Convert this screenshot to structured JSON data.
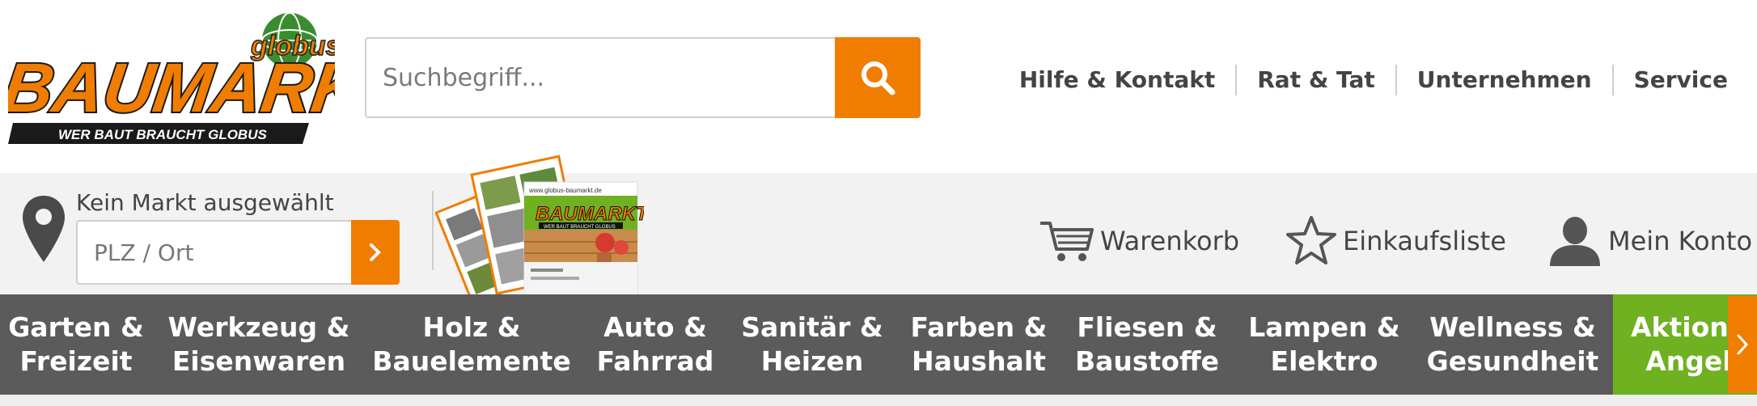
{
  "logo": {
    "brand_top": "globus",
    "brand_main": "BAUMARKT",
    "tagline": "WER BAUT BRAUCHT GLOBUS"
  },
  "search": {
    "placeholder": "Suchbegriff...",
    "button_icon": "search-icon"
  },
  "top_nav": {
    "items": [
      "Hilfe & Kontakt",
      "Rat & Tat",
      "Unternehmen",
      "Service"
    ]
  },
  "market": {
    "label": "Kein Markt ausgewählt",
    "placeholder": "PLZ / Ort",
    "pin_icon": "map-pin-icon",
    "submit_icon": "chevron-right-icon"
  },
  "brochure": {
    "brand_text": "BAUMARKT",
    "tagline": "WER BAUT BRAUCHT GLOBUS",
    "url_text": "www.globus-baumarkt.de"
  },
  "utilities": {
    "cart": "Warenkorb",
    "shopping_list": "Einkaufsliste",
    "account": "Mein Konto"
  },
  "categories": [
    {
      "line1": "Garten &",
      "line2": "Freizeit"
    },
    {
      "line1": "Werkzeug &",
      "line2": "Eisenwaren"
    },
    {
      "line1": "Holz &",
      "line2": "Bauelemente"
    },
    {
      "line1": "Auto &",
      "line2": "Fahrrad"
    },
    {
      "line1": "Sanitär &",
      "line2": "Heizen"
    },
    {
      "line1": "Farben &",
      "line2": "Haushalt"
    },
    {
      "line1": "Fliesen &",
      "line2": "Baustoffe"
    },
    {
      "line1": "Lampen &",
      "line2": "Elektro"
    },
    {
      "line1": "Wellness &",
      "line2": "Gesundheit"
    },
    {
      "line1": "Aktione",
      "line2": "Angeb"
    }
  ],
  "colors": {
    "accent_orange": "#f07d00",
    "nav_gray": "#5b5b5b",
    "promo_green": "#6fb121",
    "text_dark": "#444444"
  }
}
